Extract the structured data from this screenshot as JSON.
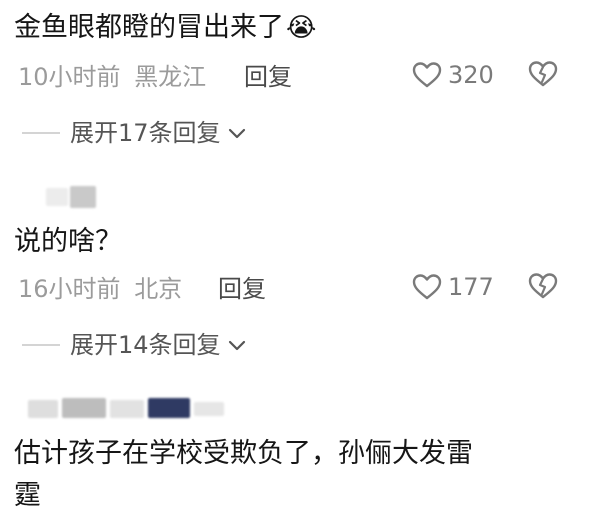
{
  "comments": [
    {
      "text": "金鱼眼都瞪的冒出来了",
      "emoji": "😭",
      "time": "10小时前",
      "location": "黑龙江",
      "reply_label": "回复",
      "likes": "320",
      "expand_label": "展开17条回复"
    },
    {
      "text": "说的啥？",
      "time": "16小时前",
      "location": "北京",
      "reply_label": "回复",
      "likes": "177",
      "expand_label": "展开14条回复"
    },
    {
      "text_line1": "估计孩子在学校受欺负了，孙俪大发雷",
      "text_line2": "霆"
    }
  ],
  "colors": {
    "text": "#161616",
    "meta": "#9b9b9b",
    "reply": "#4a4a4a",
    "divider": "#d4d4d4"
  },
  "icons": {
    "like": "heart-outline-icon",
    "dislike": "broken-heart-icon",
    "expand": "chevron-down-icon",
    "emoji": "crying-face-emoji"
  }
}
